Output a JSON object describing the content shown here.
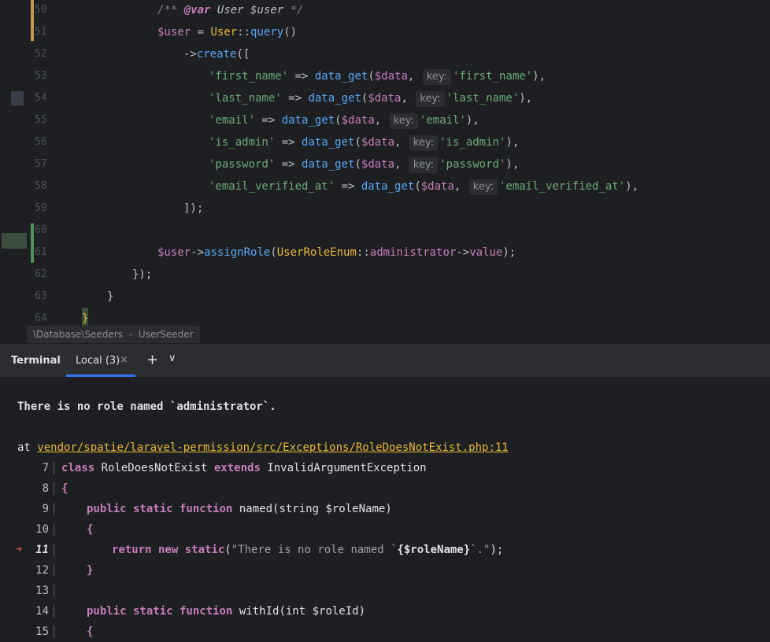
{
  "editor": {
    "lines": [
      {
        "num": "50"
      },
      {
        "num": "51"
      },
      {
        "num": "52"
      },
      {
        "num": "53"
      },
      {
        "num": "54"
      },
      {
        "num": "55"
      },
      {
        "num": "56"
      },
      {
        "num": "57"
      },
      {
        "num": "58"
      },
      {
        "num": "59"
      },
      {
        "num": "60"
      },
      {
        "num": "61"
      },
      {
        "num": "62"
      },
      {
        "num": "63"
      },
      {
        "num": "64"
      }
    ],
    "hint_label": "key:",
    "l50": {
      "open": "/**",
      "tag": "@var",
      "type": "User $user",
      "close": "*/"
    },
    "l51": {
      "var": "$user",
      "eq": " = ",
      "cls": "User",
      "sep": "::",
      "fn": "query",
      "rest": "()"
    },
    "l52": {
      "arrow": "->",
      "fn": "create",
      "rest": "(["
    },
    "fields": [
      {
        "key": "'first_name'",
        "arg": "'first_name'"
      },
      {
        "key": "'last_name'",
        "arg": "'last_name'"
      },
      {
        "key": "'email'",
        "arg": "'email'"
      },
      {
        "key": "'is_admin'",
        "arg": "'is_admin'"
      },
      {
        "key": "'password'",
        "arg": "'password'"
      },
      {
        "key": "'email_verified_at'",
        "arg": "'email_verified_at'"
      }
    ],
    "field_arrow": " => ",
    "field_fn": "data_get",
    "field_open": "(",
    "field_var": "$data",
    "field_comma": ", ",
    "field_close": "),",
    "l59": "]);",
    "l61": {
      "var": "$user",
      "arrow": "->",
      "fn": "assignRole",
      "open": "(",
      "cls": "UserRoleEnum",
      "sep": "::",
      "const": "administrator",
      "arrow2": "->",
      "prop": "value",
      "close": ");"
    },
    "l62": "});",
    "l63": "}",
    "l64": "}"
  },
  "breadcrumb": {
    "namespace": "\\Database\\Seeders",
    "class": "UserSeeder",
    "sep": "›"
  },
  "terminal_tabs": {
    "title": "Terminal",
    "local": "Local (3)",
    "close": "×",
    "add": "+",
    "more": "∨"
  },
  "terminal": {
    "error": "There is no role named `administrator`.",
    "at_label": "at ",
    "path": "vendor/spatie/laravel-permission/src/Exceptions/RoleDoesNotExist.php:11",
    "arrow": "➜",
    "lines": [
      {
        "num": "7"
      },
      {
        "num": "8"
      },
      {
        "num": "9"
      },
      {
        "num": "10"
      },
      {
        "num": "11"
      },
      {
        "num": "12"
      },
      {
        "num": "13"
      },
      {
        "num": "14"
      },
      {
        "num": "15"
      }
    ],
    "t7": {
      "k1": "class",
      "c1": " RoleDoesNotExist ",
      "k2": "extends",
      "c2": " InvalidArgumentException"
    },
    "t8": "{",
    "t9": {
      "k": "public static function",
      "rest": " named(string $roleName)"
    },
    "t10": "{",
    "t11": {
      "k": "return new static",
      "open": "(",
      "s1": "\"There is no role named `",
      "b": "{$roleName}",
      "s2": "`.\"",
      "close": ");"
    },
    "t12": "}",
    "t14": {
      "k": "public static function",
      "rest": " withId(int $roleId)"
    },
    "t15": "{"
  }
}
